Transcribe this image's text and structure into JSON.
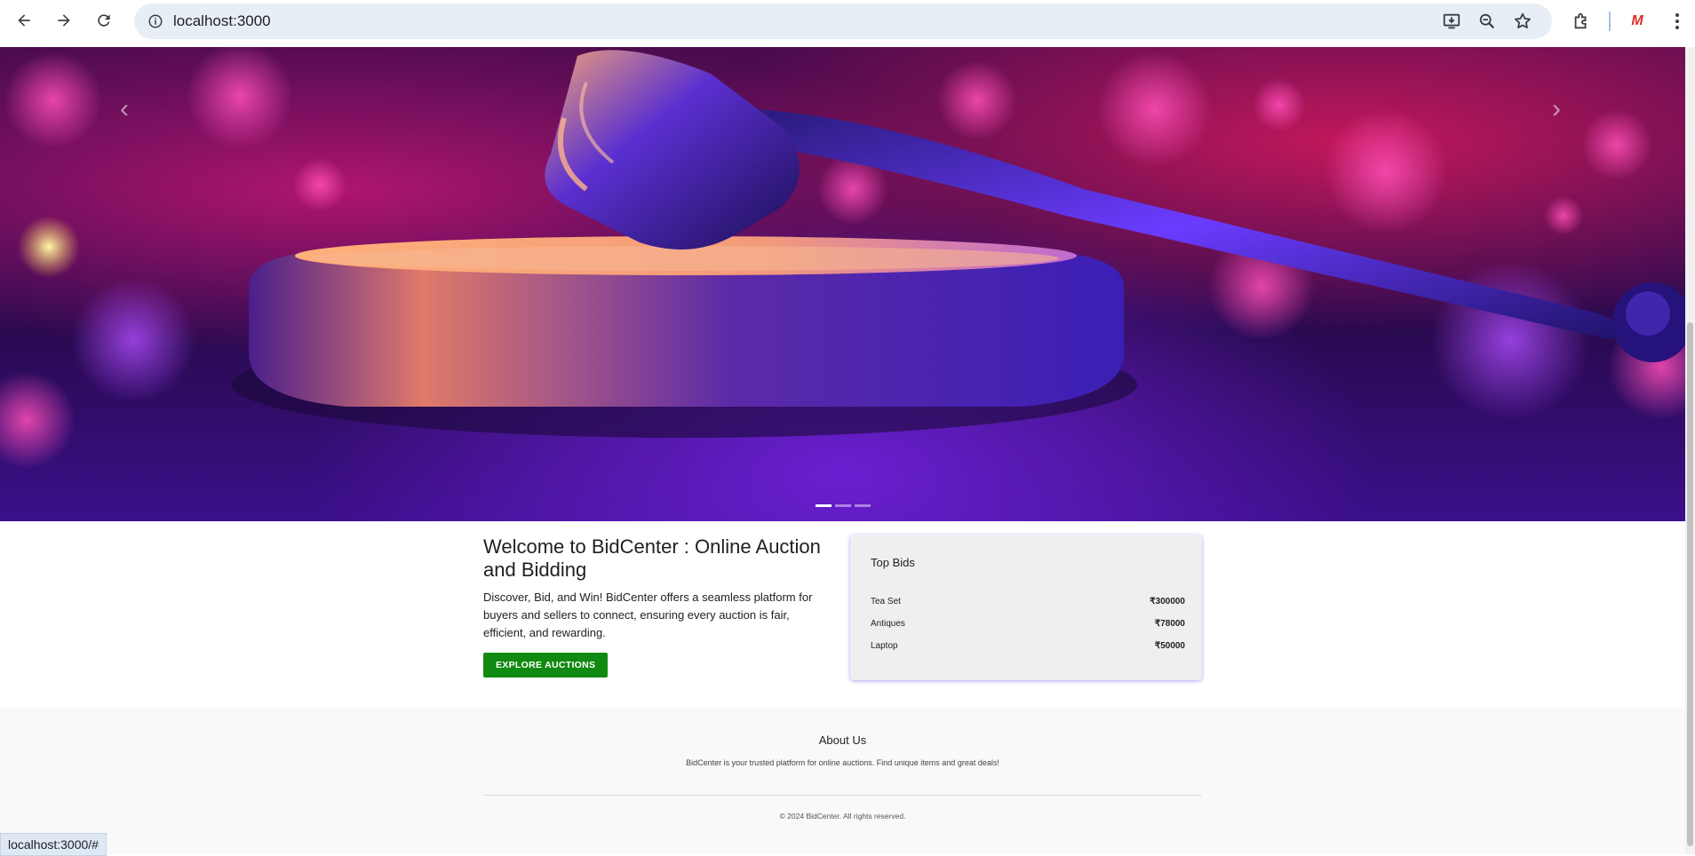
{
  "browser": {
    "url": "localhost:3000",
    "status_url": "localhost:3000/#",
    "profile_initial": "M",
    "icons": [
      "back-icon",
      "forward-icon",
      "reload-icon",
      "site-info-icon",
      "install-icon",
      "zoom-icon",
      "bookmark-star-icon",
      "extensions-icon",
      "more-menu-icon"
    ]
  },
  "hero": {
    "prev_glyph": "‹",
    "next_glyph": "›",
    "slides": 3,
    "active_slide": 1
  },
  "welcome": {
    "title": "Welcome to BidCenter : Online Auction and Bidding",
    "description": "Discover, Bid, and Win! BidCenter offers a seamless platform for buyers and sellers to connect, ensuring every auction is fair, efficient, and rewarding.",
    "cta_label": "EXPLORE AUCTIONS",
    "cta_color": "#118a11"
  },
  "top_bids": {
    "title": "Top Bids",
    "items": [
      {
        "name": "Tea Set",
        "amount": "₹300000"
      },
      {
        "name": "Antiques",
        "amount": "₹78000"
      },
      {
        "name": "Laptop",
        "amount": "₹50000"
      }
    ]
  },
  "footer": {
    "about_title": "About Us",
    "about_text": "BidCenter is your trusted platform for online auctions. Find unique items and great deals!",
    "copyright": "© 2024 BidCenter. All rights reserved."
  }
}
